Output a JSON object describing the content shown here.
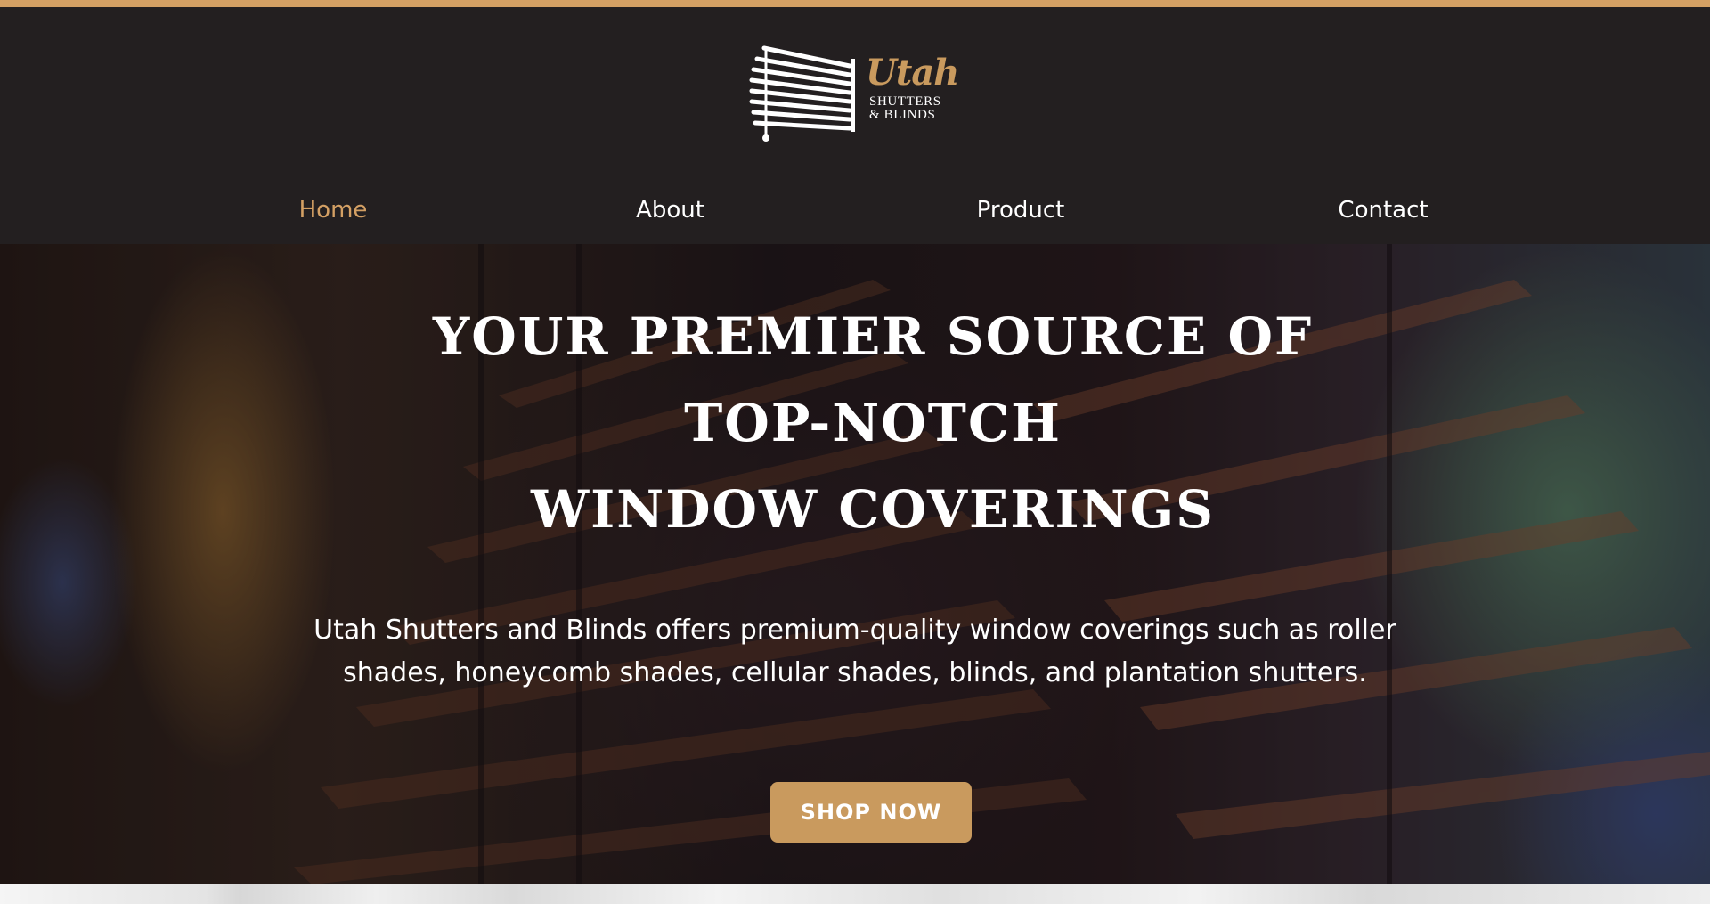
{
  "brand": {
    "logo_script": "Utah",
    "logo_line1": "SHUTTERS",
    "logo_line2": "& BLINDS",
    "accent_color": "#d4a064",
    "header_bg": "#231f20"
  },
  "nav": {
    "active": "Home",
    "items": [
      {
        "label": "Home"
      },
      {
        "label": "About"
      },
      {
        "label": "Product"
      },
      {
        "label": "Contact"
      }
    ]
  },
  "hero": {
    "title_lines": [
      "YOUR PREMIER SOURCE OF",
      "TOP-NOTCH",
      "WINDOW COVERINGS"
    ],
    "description": "Utah Shutters and Blinds offers premium-quality window coverings such as roller shades, honeycomb shades, cellular shades, blinds, and plantation shutters.",
    "cta_label": "SHOP NOW",
    "cta_color": "#c99a5e"
  }
}
